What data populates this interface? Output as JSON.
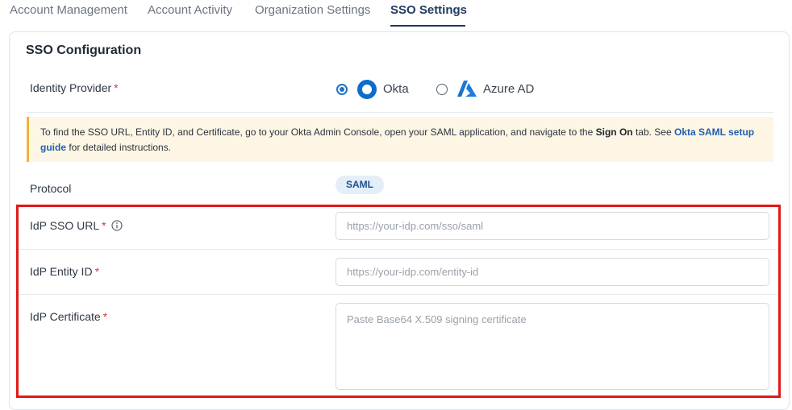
{
  "tabs": [
    {
      "label": "Account Management",
      "active": false
    },
    {
      "label": "Account Activity",
      "active": false
    },
    {
      "label": "Organization Settings",
      "active": false
    },
    {
      "label": "SSO Settings",
      "active": true
    }
  ],
  "section": {
    "title": "SSO Configuration"
  },
  "identity_provider": {
    "label": "Identity Provider",
    "required_mark": "*",
    "options": [
      {
        "label": "Okta",
        "selected": true,
        "icon": "okta-logo-icon"
      },
      {
        "label": "Azure AD",
        "selected": false,
        "icon": "azure-ad-logo-icon"
      }
    ]
  },
  "notice": {
    "text_1": "To find the SSO URL, Entity ID, and Certificate, go to your Okta Admin Console, open your SAML application, and navigate to the ",
    "bold": "Sign On",
    "text_2": " tab. See ",
    "link": "Okta SAML setup guide",
    "text_3": " for detailed instructions."
  },
  "protocol": {
    "label": "Protocol",
    "value": "SAML"
  },
  "fields": {
    "sso_url": {
      "label": "IdP SSO URL",
      "required_mark": "*",
      "value": "",
      "placeholder": "https://your-idp.com/sso/saml"
    },
    "entity_id": {
      "label": "IdP Entity ID",
      "required_mark": "*",
      "value": "",
      "placeholder": "https://your-idp.com/entity-id"
    },
    "certificate": {
      "label": "IdP Certificate",
      "required_mark": "*",
      "value": "",
      "placeholder": "Paste Base64 X.509 signing certificate"
    }
  },
  "colors": {
    "accent": "#1f73c8",
    "required": "#d43a3a",
    "highlight": "#e01919",
    "notice_bg": "#fdf6e4",
    "notice_border": "#f0b33a"
  }
}
